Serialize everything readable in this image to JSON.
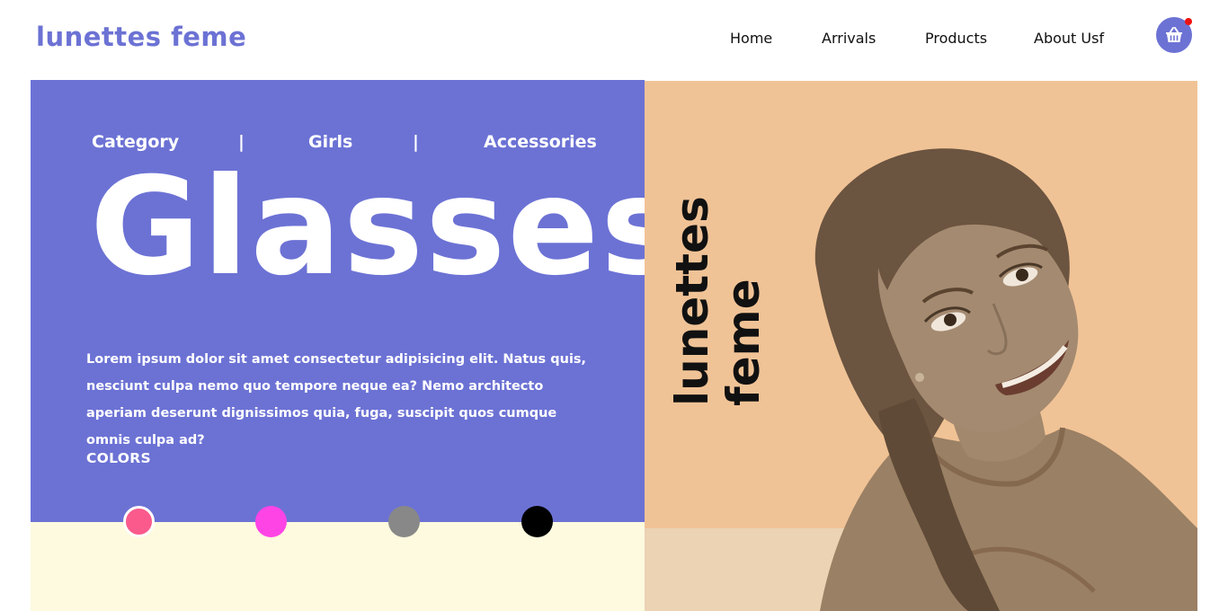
{
  "header": {
    "logo": "lunettes feme",
    "nav": [
      "Home",
      "Arrivals",
      "Products",
      "About Usf"
    ],
    "cart_icon": "basket-icon",
    "cart_badge_color": "#ee1111"
  },
  "hero": {
    "breadcrumb": {
      "category": "Category",
      "separator": "|",
      "girls": "Girls",
      "accessories": "Accessories"
    },
    "title": "Glasses",
    "description": "Lorem ipsum dolor sit amet consectetur adipisicing elit. Natus quis, nesciunt culpa nemo quo tempore neque ea? Nemo architecto aperiam deserunt dignissimos quia, fuga, suscipit quos cumque omnis culpa ad?",
    "colors_label": "COLORS",
    "swatches": [
      "#fa5a8c",
      "#ff44e6",
      "#888888",
      "#000000"
    ]
  },
  "side": {
    "vertical_line1": "lunettes",
    "vertical_line2": "feme"
  },
  "theme": {
    "primary": "#6c72d4",
    "peach": "#f0c396",
    "cream": "#fdfadf"
  }
}
